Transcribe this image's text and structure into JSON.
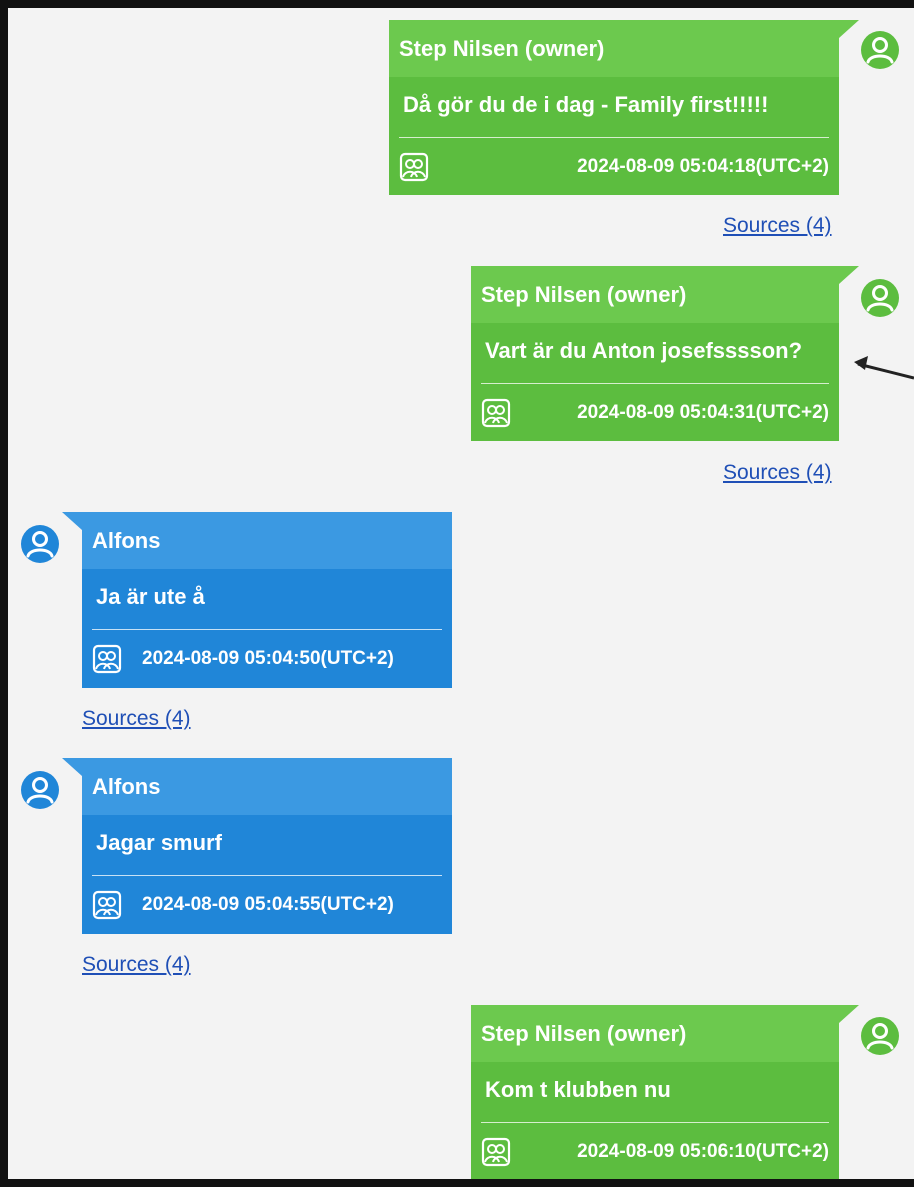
{
  "messages": [
    {
      "sender": "Step Nilsen (owner)",
      "text": "Då gör du de i dag - Family first!!!!!",
      "timestamp": "2024-08-09 05:04:18(UTC+2)",
      "sources": "Sources (4)",
      "side": "right",
      "color": "#5cbd3f",
      "avatar_icon": "user-icon",
      "footer_icon": "contacts-icon"
    },
    {
      "sender": "Step Nilsen (owner)",
      "text": "Vart är du Anton josefsssson?",
      "timestamp": "2024-08-09 05:04:31(UTC+2)",
      "sources": "Sources (4)",
      "side": "right",
      "color": "#5cbd3f",
      "avatar_icon": "user-icon",
      "footer_icon": "contacts-icon"
    },
    {
      "sender": "Alfons",
      "text": "Ja är ute å",
      "timestamp": "2024-08-09 05:04:50(UTC+2)",
      "sources": "Sources (4)",
      "side": "left",
      "color": "#2086d8",
      "avatar_icon": "user-icon",
      "footer_icon": "contacts-icon"
    },
    {
      "sender": "Alfons",
      "text": "Jagar smurf",
      "timestamp": "2024-08-09 05:04:55(UTC+2)",
      "sources": "Sources (4)",
      "side": "left",
      "color": "#2086d8",
      "avatar_icon": "user-icon",
      "footer_icon": "contacts-icon"
    },
    {
      "sender": "Step Nilsen (owner)",
      "text": "Kom t klubben nu",
      "timestamp": "2024-08-09 05:06:10(UTC+2)",
      "sources": "",
      "side": "right",
      "color": "#5cbd3f",
      "avatar_icon": "user-icon",
      "footer_icon": "contacts-icon"
    }
  ],
  "annotation": {
    "icon": "arrow-left-icon"
  }
}
